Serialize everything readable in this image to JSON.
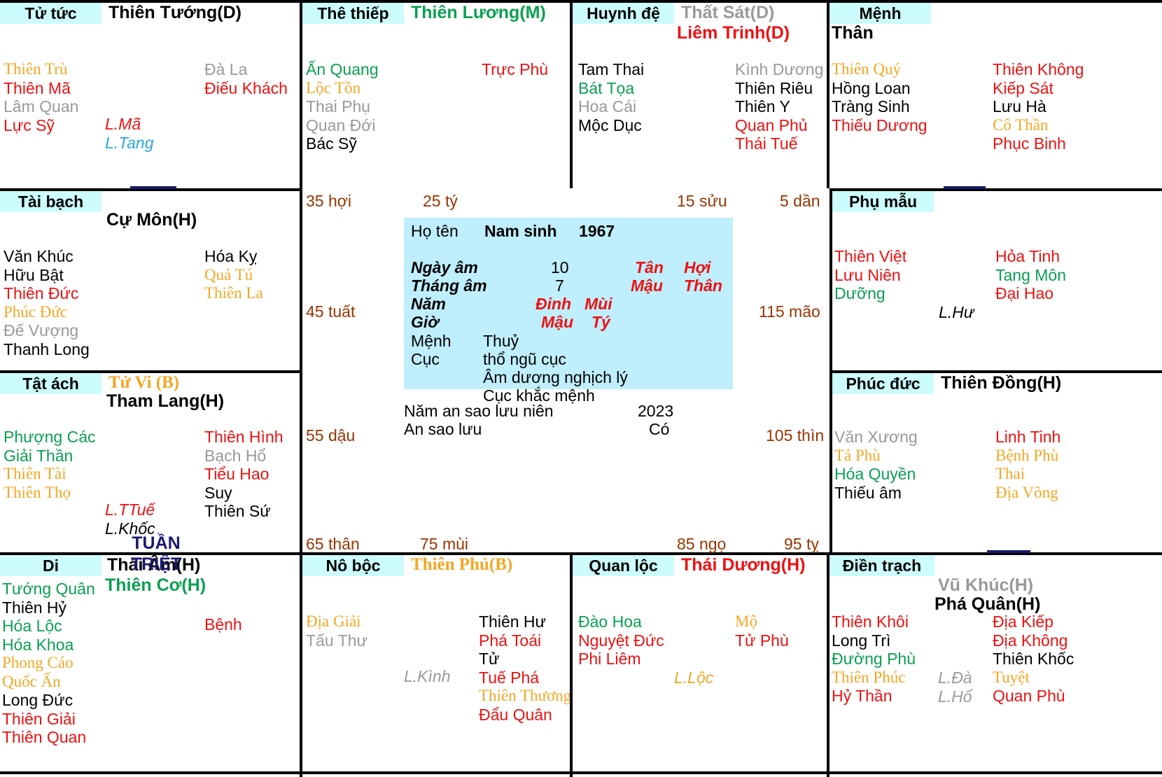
{
  "meta": {
    "colors": {
      "palace_header_bg": "#ccfcfc",
      "info_box_bg": "#bfeefc",
      "red": "#ee1111",
      "green": "#0aa050",
      "gray": "#999999",
      "orange": "#f5a623",
      "navy": "#191970",
      "brown": "#993300",
      "blue": "#29a7e8"
    }
  },
  "center": {
    "name_label": "Họ tên",
    "gender_label": "Nam sinh",
    "birth_year": "1967",
    "rows": [
      {
        "label": "Ngày âm",
        "value": "10",
        "can": "Tân",
        "chi": "Hợi"
      },
      {
        "label": "Tháng âm",
        "value": "7",
        "can": "Mậu",
        "chi": "Thân"
      },
      {
        "label": "Năm",
        "value": "",
        "can": "Đinh",
        "chi": "Mùi"
      },
      {
        "label": "Giờ",
        "value": "",
        "can": "Mậu",
        "chi": "Tý"
      }
    ],
    "menh_label": "Mệnh",
    "menh_value": "Thuỷ",
    "cuc_label": "Cục",
    "cuc_value": "thổ ngũ cục",
    "note1": "Âm dương nghịch lý",
    "note2": "Cục khắc mệnh",
    "luu_nien_label": "Năm an sao lưu niên",
    "luu_nien_value": "2023",
    "an_sao_label": "An sao lưu",
    "an_sao_value": "Có"
  },
  "tuan_triet": {
    "tuan": "TUẦN",
    "triet": "TRIỆT"
  },
  "ages": [
    {
      "text": "35 hợi"
    },
    {
      "text": "25 tý"
    },
    {
      "text": "15 sửu"
    },
    {
      "text": "5 dần"
    },
    {
      "text": "45 tuất"
    },
    {
      "text": "115 mão"
    },
    {
      "text": "55 dậu"
    },
    {
      "text": "105 thìn"
    },
    {
      "text": "65 thân"
    },
    {
      "text": "75 mùi"
    },
    {
      "text": "85 ngọ"
    },
    {
      "text": "95 tỵ"
    }
  ],
  "palaces": [
    {
      "id": "tu-tuc",
      "name": "Tử tức",
      "main_stars": [
        {
          "text": "Thiên Tướng(D)",
          "color": "black"
        }
      ],
      "left_col": [
        {
          "text": "Thiên Trù",
          "color": "orange",
          "serif": true
        },
        {
          "text": "Thiên Mã",
          "color": "red"
        },
        {
          "text": "Lâm Quan",
          "color": "gray"
        },
        {
          "text": "Lực Sỹ",
          "color": "red"
        }
      ],
      "mid_col": [
        {
          "text": "L.Mã",
          "color": "red",
          "italic": true
        },
        {
          "text": "L.Tang",
          "color": "blue",
          "italic": true
        }
      ],
      "right_col": [
        {
          "text": "Đà La",
          "color": "gray"
        },
        {
          "text": "Điếu Khách",
          "color": "red"
        }
      ]
    },
    {
      "id": "the-thiep",
      "name": "Thê thiếp",
      "main_stars": [
        {
          "text": "Thiên Lương(M)",
          "color": "green"
        }
      ],
      "left_col": [
        {
          "text": "Ấn Quang",
          "color": "green"
        },
        {
          "text": "Lộc Tồn",
          "color": "orange",
          "serif": true
        },
        {
          "text": "Thai Phụ",
          "color": "gray"
        },
        {
          "text": "Quan Đới",
          "color": "gray"
        },
        {
          "text": "Bác Sỹ",
          "color": "black"
        }
      ],
      "mid_col": [],
      "right_col": [
        {
          "text": "Trực Phù",
          "color": "red"
        }
      ]
    },
    {
      "id": "huynh-de",
      "name": "Huynh đệ",
      "main_stars": [
        {
          "text": "Thất Sát(D)",
          "color": "gray"
        },
        {
          "text": "Liêm Trinh(D)",
          "color": "red"
        }
      ],
      "left_col": [
        {
          "text": "Tam Thai",
          "color": "black"
        },
        {
          "text": "Bát Tọa",
          "color": "green"
        },
        {
          "text": "Hoa Cái",
          "color": "gray"
        },
        {
          "text": "Mộc Dục",
          "color": "black"
        }
      ],
      "mid_col": [],
      "right_col": [
        {
          "text": "Kình Dương",
          "color": "gray"
        },
        {
          "text": "Thiên Riêu",
          "color": "black"
        },
        {
          "text": "Thiên Y",
          "color": "black"
        },
        {
          "text": "Quan Phủ",
          "color": "red"
        },
        {
          "text": "Thái Tuế",
          "color": "red"
        }
      ]
    },
    {
      "id": "menh",
      "name": "Mệnh",
      "than_label": "Thân",
      "main_stars": [],
      "left_col": [
        {
          "text": "Thiên Quý",
          "color": "orange",
          "serif": true
        },
        {
          "text": "Hồng Loan",
          "color": "black"
        },
        {
          "text": "Tràng Sinh",
          "color": "black"
        },
        {
          "text": "Thiếu Dương",
          "color": "red"
        }
      ],
      "mid_col": [],
      "right_col": [
        {
          "text": "Thiên Không",
          "color": "red"
        },
        {
          "text": "Kiếp Sát",
          "color": "red"
        },
        {
          "text": "Lưu Hà",
          "color": "black"
        },
        {
          "text": "Cô Thần",
          "color": "orange",
          "serif": true
        },
        {
          "text": "Phục Binh",
          "color": "red"
        }
      ]
    },
    {
      "id": "tai-bach",
      "name": "Tài bạch",
      "main_stars": [
        {
          "text": "Cự Môn(H)",
          "color": "black"
        }
      ],
      "left_col": [
        {
          "text": "Văn Khúc",
          "color": "black"
        },
        {
          "text": "Hữu Bật",
          "color": "black"
        },
        {
          "text": "Thiên Đức",
          "color": "red"
        },
        {
          "text": "Phúc Đức",
          "color": "orange",
          "serif": true
        },
        {
          "text": "Đế Vượng",
          "color": "gray"
        },
        {
          "text": "Thanh Long",
          "color": "black"
        }
      ],
      "mid_col": [],
      "right_col": [
        {
          "text": "Hóa Kỵ",
          "color": "black"
        },
        {
          "text": "Quả Tú",
          "color": "orange",
          "serif": true
        },
        {
          "text": "Thiên La",
          "color": "orange",
          "serif": true
        }
      ]
    },
    {
      "id": "phu-mau",
      "name": "Phụ mẫu",
      "main_stars": [],
      "left_col": [
        {
          "text": "Thiên Việt",
          "color": "red"
        },
        {
          "text": "Lưu Niên",
          "color": "red"
        },
        {
          "text": "Dưỡng",
          "color": "green"
        }
      ],
      "mid_col": [
        {
          "text": "L.Hư",
          "color": "black",
          "italic": true
        }
      ],
      "right_col": [
        {
          "text": "Hỏa Tinh",
          "color": "red"
        },
        {
          "text": "Tang Môn",
          "color": "green"
        },
        {
          "text": "Đại Hao",
          "color": "red"
        }
      ]
    },
    {
      "id": "tat-ach",
      "name": "Tật ách",
      "main_stars": [
        {
          "text": "Tử Vi (B)",
          "color": "orange",
          "serif": true
        },
        {
          "text": "Tham Lang(H)",
          "color": "black"
        }
      ],
      "left_col": [
        {
          "text": "Phượng Các",
          "color": "green"
        },
        {
          "text": "Giải Thần",
          "color": "green"
        },
        {
          "text": "Thiên Tài",
          "color": "orange",
          "serif": true
        },
        {
          "text": "Thiên Thọ",
          "color": "orange",
          "serif": true
        }
      ],
      "mid_col": [
        {
          "text": "L.TTuế",
          "color": "red",
          "italic": true
        },
        {
          "text": "L.Khốc",
          "color": "black",
          "italic": true
        }
      ],
      "right_col": [
        {
          "text": "Thiên Hình",
          "color": "red"
        },
        {
          "text": "Bạch Hổ",
          "color": "gray"
        },
        {
          "text": "Tiểu Hao",
          "color": "red"
        },
        {
          "text": "Suy",
          "color": "black"
        },
        {
          "text": "Thiên Sứ",
          "color": "black"
        }
      ]
    },
    {
      "id": "phuc-duc",
      "name": "Phúc đức",
      "main_stars": [
        {
          "text": "Thiên Đồng(H)",
          "color": "black"
        }
      ],
      "left_col": [
        {
          "text": "Văn Xương",
          "color": "gray"
        },
        {
          "text": "Tả Phù",
          "color": "orange",
          "serif": true
        },
        {
          "text": "Hóa Quyền",
          "color": "green"
        },
        {
          "text": "Thiếu âm",
          "color": "black"
        }
      ],
      "mid_col": [],
      "right_col": [
        {
          "text": "Linh Tinh",
          "color": "red"
        },
        {
          "text": "Bệnh Phù",
          "color": "orange",
          "serif": true
        },
        {
          "text": "Thai",
          "color": "orange",
          "serif": true
        },
        {
          "text": "Địa Võng",
          "color": "orange",
          "serif": true
        }
      ]
    },
    {
      "id": "di",
      "name": "Di",
      "main_stars": [
        {
          "text": "Thái Âm(H)",
          "color": "black"
        },
        {
          "text": "Thiên Cơ(H)",
          "color": "green"
        }
      ],
      "left_col": [
        {
          "text": "Tướng Quân",
          "color": "green"
        },
        {
          "text": "Thiên Hỷ",
          "color": "black"
        },
        {
          "text": "Hóa Lộc",
          "color": "green"
        },
        {
          "text": "Hóa Khoa",
          "color": "green"
        },
        {
          "text": "Phong Cáo",
          "color": "orange",
          "serif": true
        },
        {
          "text": "Quốc Ấn",
          "color": "orange",
          "serif": true
        },
        {
          "text": "Long Đức",
          "color": "black"
        },
        {
          "text": "Thiên Giải",
          "color": "red"
        },
        {
          "text": "Thiên Quan",
          "color": "red"
        }
      ],
      "mid_col": [],
      "right_col": [
        {
          "text": "Bệnh",
          "color": "red"
        }
      ]
    },
    {
      "id": "no-boc",
      "name": "Nô bộc",
      "main_stars": [
        {
          "text": "Thiên Phủ(B)",
          "color": "orange",
          "serif": true
        }
      ],
      "left_col": [
        {
          "text": "Địa Giải",
          "color": "orange",
          "serif": true
        },
        {
          "text": "Tấu Thư",
          "color": "gray"
        }
      ],
      "mid_col": [
        {
          "text": "L.Kình",
          "color": "gray",
          "italic": true
        }
      ],
      "right_col": [
        {
          "text": "Thiên Hư",
          "color": "black"
        },
        {
          "text": "Phá Toái",
          "color": "red"
        },
        {
          "text": "Tử",
          "color": "black"
        },
        {
          "text": "Tuế Phá",
          "color": "red"
        },
        {
          "text": "Thiên Thương",
          "color": "orange",
          "serif": true
        },
        {
          "text": "Đẩu Quân",
          "color": "red"
        }
      ]
    },
    {
      "id": "quan-loc",
      "name": "Quan lộc",
      "main_stars": [
        {
          "text": "Thái Dương(H)",
          "color": "red"
        }
      ],
      "left_col": [
        {
          "text": "Đào Hoa",
          "color": "green"
        },
        {
          "text": "Nguyệt Đức",
          "color": "red"
        },
        {
          "text": "Phi Liêm",
          "color": "red"
        }
      ],
      "mid_col": [
        {
          "text": "L.Lộc",
          "color": "orange",
          "italic": true
        }
      ],
      "right_col": [
        {
          "text": "Mộ",
          "color": "orange",
          "serif": true
        },
        {
          "text": "Tử Phù",
          "color": "red"
        }
      ]
    },
    {
      "id": "dien-trach",
      "name": "Điền trạch",
      "main_stars": [
        {
          "text": "Vũ Khúc(H)",
          "color": "gray"
        },
        {
          "text": "Phá Quân(H)",
          "color": "black"
        }
      ],
      "left_col": [
        {
          "text": "Thiên Khôi",
          "color": "red"
        },
        {
          "text": "Long Trì",
          "color": "black"
        },
        {
          "text": "Đường Phù",
          "color": "green"
        },
        {
          "text": "Thiên Phúc",
          "color": "orange",
          "serif": true
        },
        {
          "text": "Hỷ Thần",
          "color": "red"
        }
      ],
      "mid_col": [
        {
          "text": "L.Đà",
          "color": "gray",
          "italic": true
        },
        {
          "text": "L.Hổ",
          "color": "gray",
          "italic": true
        }
      ],
      "right_col": [
        {
          "text": "Địa Kiếp",
          "color": "red"
        },
        {
          "text": "Địa Không",
          "color": "red"
        },
        {
          "text": "Thiên Khốc",
          "color": "black"
        },
        {
          "text": "Tuyệt",
          "color": "orange",
          "serif": true
        },
        {
          "text": "Quan Phù",
          "color": "red"
        }
      ]
    }
  ]
}
